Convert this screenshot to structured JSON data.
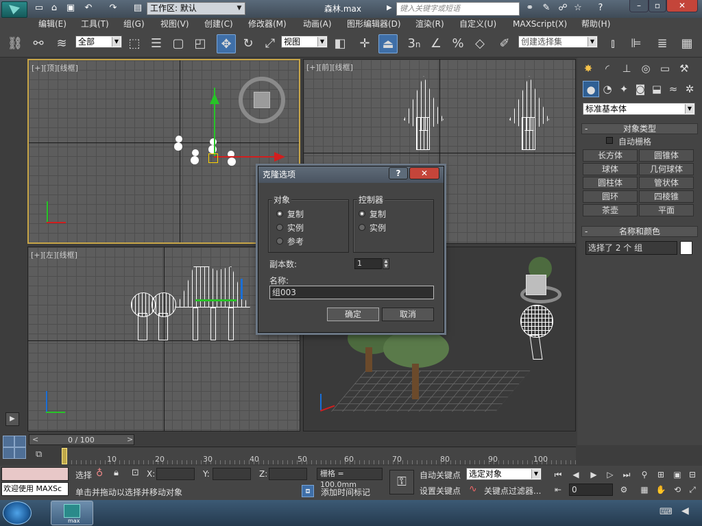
{
  "app": {
    "filename": "森林.max",
    "workspace_label": "工作区: 默认",
    "search_placeholder": "键入关键字或短语"
  },
  "menu": [
    "编辑(E)",
    "工具(T)",
    "组(G)",
    "视图(V)",
    "创建(C)",
    "修改器(M)",
    "动画(A)",
    "图形编辑器(D)",
    "渲染(R)",
    "自定义(U)",
    "MAXScript(X)",
    "帮助(H)"
  ],
  "toolbar": {
    "selection_filter": "全部",
    "ref_coord": "视图",
    "snap_3": "3",
    "snap_n": "n",
    "named_selection": "创建选择集"
  },
  "viewports": {
    "top": "[+][顶][线框]",
    "front": "[+][前][线框]",
    "left": "[+][左][线框]"
  },
  "command_panel": {
    "category": "标准基本体",
    "object_type_title": "对象类型",
    "auto_grid": "自动栅格",
    "buttons": [
      "长方体",
      "圆锥体",
      "球体",
      "几何球体",
      "圆柱体",
      "管状体",
      "圆环",
      "四棱锥",
      "茶壶",
      "平面"
    ],
    "name_color_title": "名称和颜色",
    "name_value": "选择了 2 个 组",
    "name_color": "#ffffff"
  },
  "dialog": {
    "title": "克隆选项",
    "help": "?",
    "close": "✕",
    "object_group": "对象",
    "object_options": [
      "复制",
      "实例",
      "参考"
    ],
    "object_selected": 0,
    "controller_group": "控制器",
    "controller_options": [
      "复制",
      "实例"
    ],
    "controller_selected": 0,
    "copies_label": "副本数:",
    "copies_value": "1",
    "name_label": "名称:",
    "name_value": "组003",
    "ok": "确定",
    "cancel": "取消"
  },
  "timeline": {
    "frame": "0 / 100",
    "prev": "<",
    "next": ">",
    "ticks": [
      "10",
      "20",
      "30",
      "40",
      "50",
      "60",
      "70",
      "80",
      "90",
      "100"
    ]
  },
  "status": {
    "welcome": "欢迎使用 MAXSc",
    "select_label": "选择",
    "x_label": "X:",
    "y_label": "Y:",
    "z_label": "Z:",
    "grid": "栅格 = 100.0mm",
    "auto_key": "自动关键点",
    "selected_objects": "选定对象",
    "set_key": "设置关键点",
    "key_filters": "关键点过滤器...",
    "hint": "单击并拖动以选择并移动对象",
    "add_time_tag": "添加时间标记",
    "frame_value": "0"
  },
  "taskbar": {
    "app_label": "max"
  }
}
